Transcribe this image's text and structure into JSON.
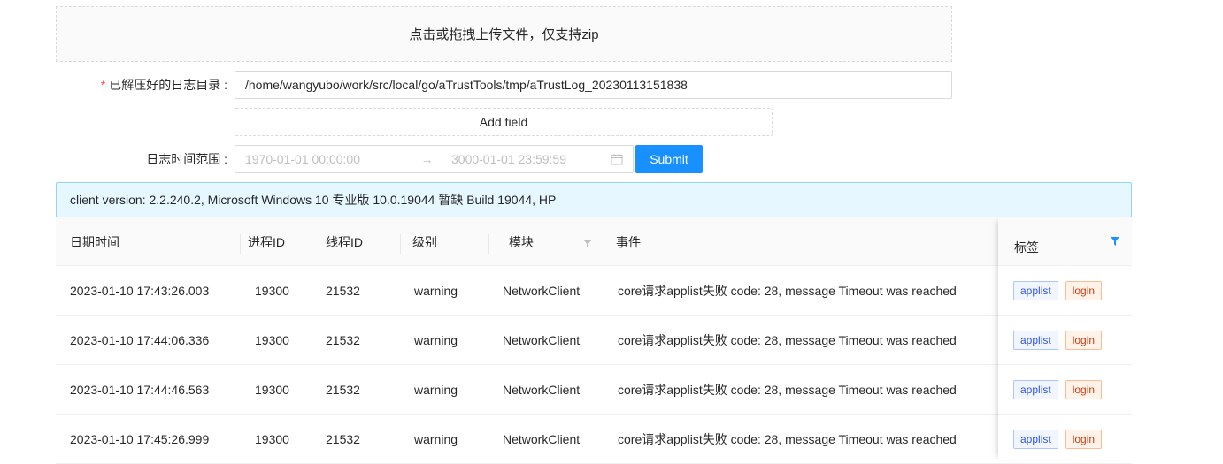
{
  "upload": {
    "label": "点击或拖拽上传文件，仅支持zip"
  },
  "log_dir": {
    "required_mark": "*",
    "label": "已解压好的日志目录",
    "colon": " :",
    "value": "/home/wangyubo/work/src/local/go/aTrustTools/tmp/aTrustLog_20230113151838"
  },
  "add_field": {
    "label": "Add field"
  },
  "time_range": {
    "label": "日志时间范围",
    "colon": " :",
    "start_placeholder": "1970-01-01 00:00:00",
    "separator": "→",
    "end_placeholder": "3000-01-01 23:59:59"
  },
  "submit": {
    "label": "Submit"
  },
  "alert": {
    "text": "client version: 2.2.240.2, Microsoft Windows 10 专业版 10.0.19044 暂缺 Build 19044, HP"
  },
  "table": {
    "columns": {
      "datetime": "日期时间",
      "pid": "进程ID",
      "tid": "线程ID",
      "level": "级别",
      "module": "模块",
      "event": "事件",
      "tags": "标签"
    },
    "rows": [
      {
        "datetime": "2023-01-10 17:43:26.003",
        "pid": "19300",
        "tid": "21532",
        "level": "warning",
        "module": "NetworkClient",
        "event": "core请求applist失败 code: 28, message Timeout was reached",
        "tags": [
          "applist",
          "login"
        ]
      },
      {
        "datetime": "2023-01-10 17:44:06.336",
        "pid": "19300",
        "tid": "21532",
        "level": "warning",
        "module": "NetworkClient",
        "event": "core请求applist失败 code: 28, message Timeout was reached",
        "tags": [
          "applist",
          "login"
        ]
      },
      {
        "datetime": "2023-01-10 17:44:46.563",
        "pid": "19300",
        "tid": "21532",
        "level": "warning",
        "module": "NetworkClient",
        "event": "core请求applist失败 code: 28, message Timeout was reached",
        "tags": [
          "applist",
          "login"
        ]
      },
      {
        "datetime": "2023-01-10 17:45:26.999",
        "pid": "19300",
        "tid": "21532",
        "level": "warning",
        "module": "NetworkClient",
        "event": "core请求applist失败 code: 28, message Timeout was reached",
        "tags": [
          "applist",
          "login"
        ]
      }
    ]
  },
  "colors": {
    "primary": "#1890ff",
    "alert_bg": "#e6f7ff",
    "alert_border": "#91d5ff",
    "required": "#ff4d4f",
    "tag_blue": "#2f54eb",
    "tag_red": "#d4380d"
  },
  "icons": {
    "calendar": "calendar-icon",
    "filter": "filter-icon",
    "filter_active": "filter-icon"
  }
}
